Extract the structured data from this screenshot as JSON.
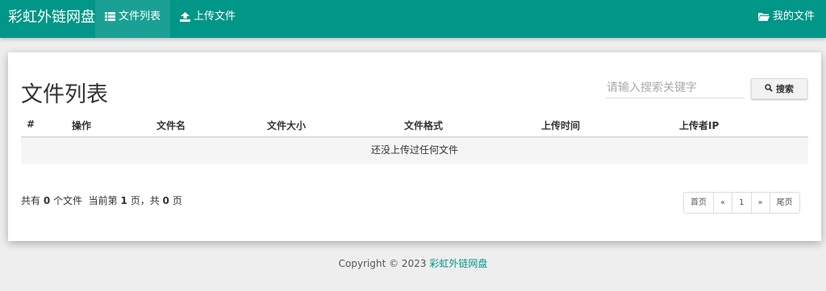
{
  "nav": {
    "brand": "彩虹外链网盘",
    "items": [
      {
        "label": "文件列表",
        "icon": "list-icon",
        "active": true
      },
      {
        "label": "上传文件",
        "icon": "upload-icon",
        "active": false
      }
    ],
    "my_files": {
      "label": "我的文件",
      "icon": "folder-open-icon"
    }
  },
  "main": {
    "title": "文件列表",
    "search": {
      "placeholder": "请输入搜索关键字",
      "value": "",
      "button_label": "搜索",
      "button_icon": "search-icon"
    },
    "table": {
      "headers": [
        "#",
        "操作",
        "文件名",
        "文件大小",
        "文件格式",
        "上传时间",
        "上传者IP"
      ],
      "empty_text": "还没上传过任何文件"
    },
    "summary": {
      "prefix": "共有",
      "count": "0",
      "mid1": "个文件  当前第",
      "current_page": "1",
      "mid2": "页，共",
      "total_pages": "0",
      "suffix": "页"
    },
    "pagination": {
      "first": "首页",
      "prev": "«",
      "current": "1",
      "next": "»",
      "last": "尾页"
    }
  },
  "footer": {
    "copyright": "Copyright © 2023",
    "site_name": "彩虹外链网盘"
  },
  "colors": {
    "primary": "#009688",
    "active_nav": "#1aa094",
    "background": "#eeeeee"
  }
}
